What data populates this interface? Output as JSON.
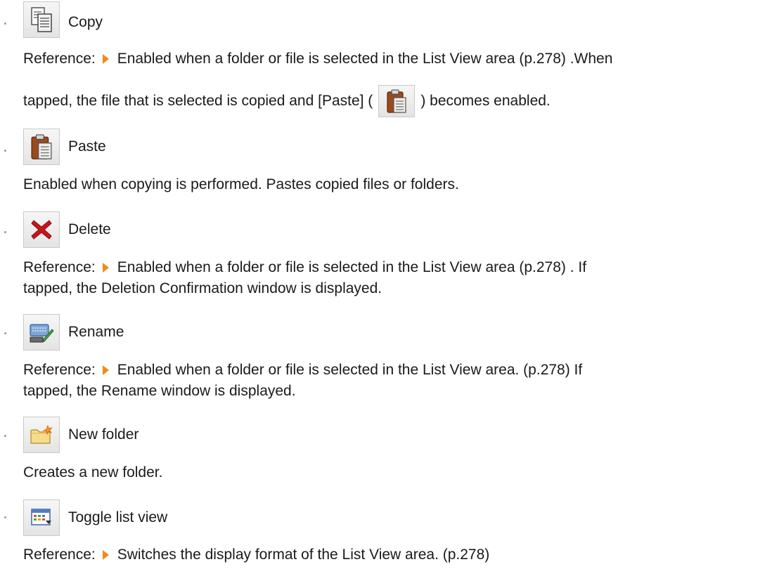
{
  "items": [
    {
      "label": "Copy",
      "icon": "copy-icon",
      "ref_prefix": "Reference:",
      "desc_line1": "Enabled when a folder or file is selected in the List View area (p.278) .When",
      "desc_line2_before": "tapped, the file that is selected is copied and [Paste] (",
      "desc_line2_after": ") becomes enabled."
    },
    {
      "label": "Paste",
      "icon": "paste-icon",
      "desc_line1": "Enabled when copying is performed. Pastes copied files or folders."
    },
    {
      "label": "Delete",
      "icon": "delete-icon",
      "ref_prefix": "Reference:",
      "desc_line1": "Enabled when a folder or file is selected in the List View area (p.278) . If",
      "desc_line2": "tapped, the Deletion Confirmation window is displayed."
    },
    {
      "label": "Rename",
      "icon": "rename-icon",
      "ref_prefix": "Reference:",
      "desc_line1": "Enabled when a folder or file is selected in the List View area. (p.278) If",
      "desc_line2": "tapped, the Rename window is displayed."
    },
    {
      "label": "New folder",
      "icon": "new-folder-icon",
      "desc_line1": "Creates a new folder."
    },
    {
      "label": "Toggle list view",
      "icon": "toggle-list-view-icon",
      "ref_prefix": "Reference:",
      "desc_line1": "Switches the display format of the List View area. (p.278)"
    }
  ],
  "colors": {
    "reference_arrow": "#f08a1c",
    "delete_x": "#c8141c"
  }
}
